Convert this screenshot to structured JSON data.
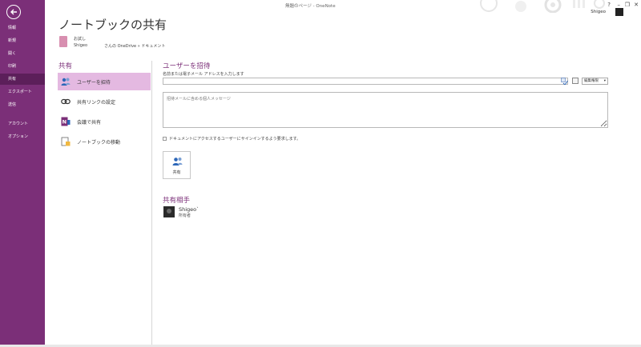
{
  "window": {
    "title": "無題のページ - OneNote",
    "controls": [
      "?",
      "–",
      "❐",
      "✕"
    ],
    "user_name": "Shigeo"
  },
  "nav": {
    "items": [
      {
        "label": "情報"
      },
      {
        "label": "新規"
      },
      {
        "label": "開く"
      },
      {
        "label": "印刷"
      },
      {
        "label": "共有"
      },
      {
        "label": "エクスポート"
      },
      {
        "label": "送信"
      },
      {
        "label": "アカウント"
      },
      {
        "label": "オプション"
      }
    ],
    "active_index": 4
  },
  "page": {
    "title": "ノートブックの共有",
    "notebook": {
      "name": "お試し",
      "owner": "Shigeo",
      "path": "さんの OneDrive » ドキュメント"
    }
  },
  "share": {
    "heading": "共有",
    "options": [
      {
        "label": "ユーザーを招待",
        "icon": "invite-people-icon"
      },
      {
        "label": "共有リンクの設定",
        "icon": "link-icon"
      },
      {
        "label": "会議で共有",
        "icon": "onenote-meeting-icon"
      },
      {
        "label": "ノートブックの移動",
        "icon": "move-notebook-icon"
      }
    ],
    "active_index": 0
  },
  "invite": {
    "heading": "ユーザーを招待",
    "name_label": "名前または電子メール アドレスを入力します",
    "name_value": "",
    "permission": "編集権限",
    "message_placeholder": "招待メールに含める個人メッセージ",
    "signin_label": "ドキュメントにアクセスするユーザーにサインインするよう要求します。",
    "signin_checked": false,
    "share_button_label": "共有"
  },
  "shared_with": {
    "heading": "共有相手",
    "people": [
      {
        "name": "Shigeo`",
        "role": "所有者"
      }
    ]
  },
  "colors": {
    "accent": "#7b2f78",
    "nav_active": "#5c1f5a",
    "option_active": "#e4b9e1"
  }
}
